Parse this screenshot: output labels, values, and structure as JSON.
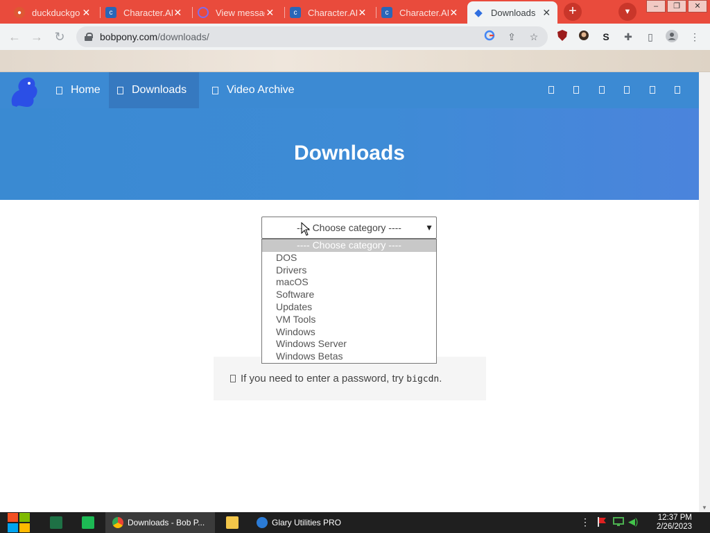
{
  "browser": {
    "tabs": [
      {
        "title": "duckduckgo",
        "favicon": "duckduckgo-icon"
      },
      {
        "title": "Character.AI",
        "favicon": "character-ai-icon"
      },
      {
        "title": "View messages",
        "favicon": "messages-icon"
      },
      {
        "title": "Character.AI",
        "favicon": "character-ai-icon"
      },
      {
        "title": "Character.AI",
        "favicon": "character-ai-icon"
      },
      {
        "title": "Downloads",
        "favicon": "bobpony-icon",
        "active": true
      }
    ],
    "url_host": "bobpony.com",
    "url_path": "/downloads/",
    "colors": {
      "tab_strip": "#e94b3c",
      "toolbar": "#f1f3f4"
    }
  },
  "site": {
    "nav": [
      {
        "label": "Home",
        "icon": "home-icon"
      },
      {
        "label": "Downloads",
        "icon": "download-icon",
        "active": true
      },
      {
        "label": "Video Archive",
        "icon": "video-icon"
      }
    ],
    "social_icons": [
      "social-icon-1",
      "social-icon-2",
      "social-icon-3",
      "social-icon-4",
      "social-icon-5",
      "social-icon-6"
    ],
    "hero_title": "Downloads",
    "colors": {
      "nav": "#3c8ad3",
      "nav_active": "#3679c0",
      "hero": "#3e8bd6"
    }
  },
  "category_select": {
    "selected": "---- Choose category ----",
    "options": [
      "---- Choose category ----",
      "DOS",
      "Drivers",
      "macOS",
      "Software",
      "Updates",
      "VM Tools",
      "Windows",
      "Windows Server",
      "Windows Betas"
    ]
  },
  "notice": {
    "text": "If you need to enter a password, try ",
    "code": "bigcdn",
    "tail": "."
  },
  "taskbar": {
    "buttons": [
      {
        "label": "Downloads - Bob P...",
        "icon": "chrome-icon",
        "active": true
      },
      {
        "label": "Glary Utilities PRO",
        "icon": "glary-utilities-icon"
      }
    ],
    "time": "12:37 PM",
    "date": "2/26/2023"
  }
}
